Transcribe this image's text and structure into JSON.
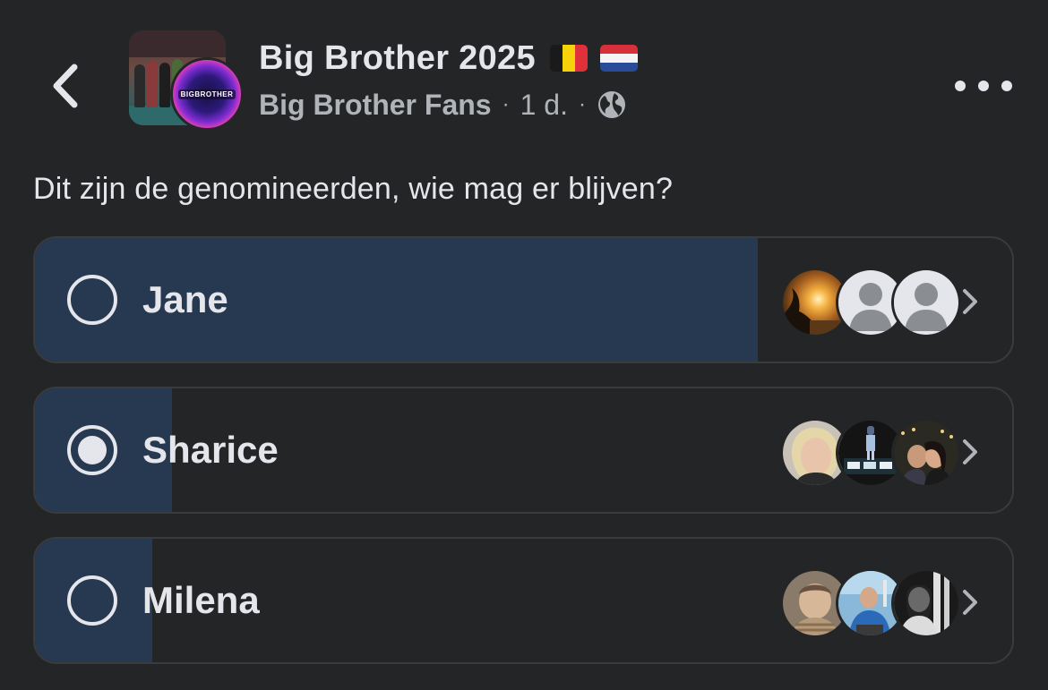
{
  "post": {
    "title": "Big Brother 2025",
    "flags": [
      "belgium-flag",
      "netherlands-flag"
    ],
    "group_name": "Big Brother Fans",
    "separator": "·",
    "time": "1 d.",
    "audience_icon": "globe-icon",
    "avatar_logo_text": "BIGBROTHER"
  },
  "header": {
    "back_icon": "chevron-left-icon",
    "more_icon": "more-horizontal-icon"
  },
  "poll": {
    "question": "Dit zijn de genomineerden, wie mag er blijven?",
    "options": [
      {
        "label": "Jane",
        "selected": false,
        "vote_share": 0.74
      },
      {
        "label": "Sharice",
        "selected": true,
        "vote_share": 0.14
      },
      {
        "label": "Milena",
        "selected": false,
        "vote_share": 0.12
      }
    ]
  },
  "colors": {
    "background": "#242526",
    "poll_fill": "#263951",
    "option_border": "#3a3b3c",
    "text_primary": "#e4e6eb",
    "text_secondary": "#b0b3b8"
  }
}
